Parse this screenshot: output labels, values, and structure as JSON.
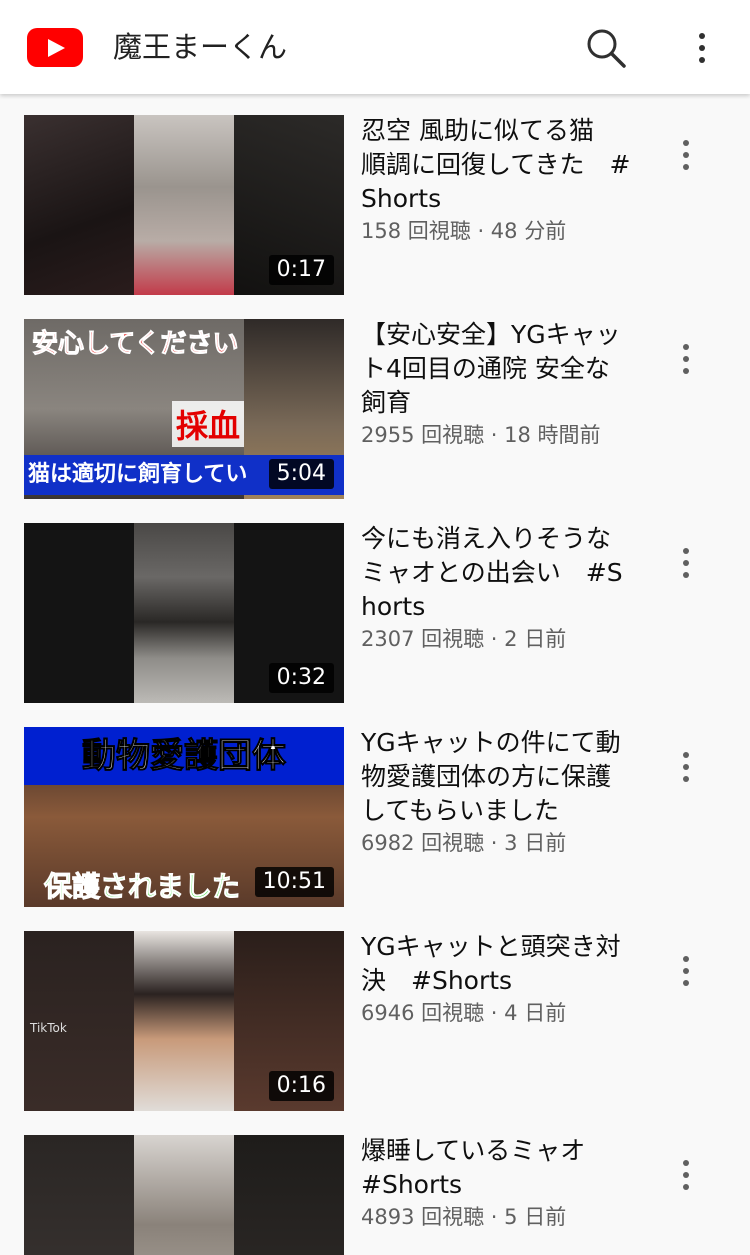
{
  "header": {
    "channel_name": "魔王まーくん",
    "icons": [
      "youtube-logo-icon",
      "search-icon",
      "more-vert-icon"
    ]
  },
  "videos": [
    {
      "title": "忍空 風助に似てる猫　順調に回復してきた　#Shorts",
      "views": "158 回視聴",
      "age": "48 分前",
      "sep": " · ",
      "duration": "0:17"
    },
    {
      "title": "【安心安全】YGキャット4回目の通院 安全な飼育",
      "views": "2955 回視聴",
      "age": "18 時間前",
      "sep": " · ",
      "duration": "5:04",
      "thumb_text": {
        "top": "安心してください",
        "middle": "採血",
        "bottom": "猫は適切に飼育してい"
      }
    },
    {
      "title": "今にも消え入りそうなミャオとの出会い　#Shorts",
      "views": "2307 回視聴",
      "age": "2 日前",
      "sep": " · ",
      "duration": "0:32"
    },
    {
      "title": "YGキャットの件にて動物愛護団体の方に保護してもらいました",
      "views": "6982 回視聴",
      "age": "3 日前",
      "sep": " · ",
      "duration": "10:51",
      "thumb_text": {
        "top": "動物愛護団体",
        "bottom": "保護されました"
      }
    },
    {
      "title": "YGキャットと頭突き対決　#Shorts",
      "views": "6946 回視聴",
      "age": "4 日前",
      "sep": " · ",
      "duration": "0:16",
      "thumb_text": {
        "logo": "TikTok"
      }
    },
    {
      "title": "爆睡しているミャオ　#Shorts",
      "views": "4893 回視聴",
      "age": "5 日前",
      "sep": " · ",
      "duration": ""
    }
  ],
  "colors": {
    "accent": "#ff0000",
    "secondary_text": "#606060"
  }
}
